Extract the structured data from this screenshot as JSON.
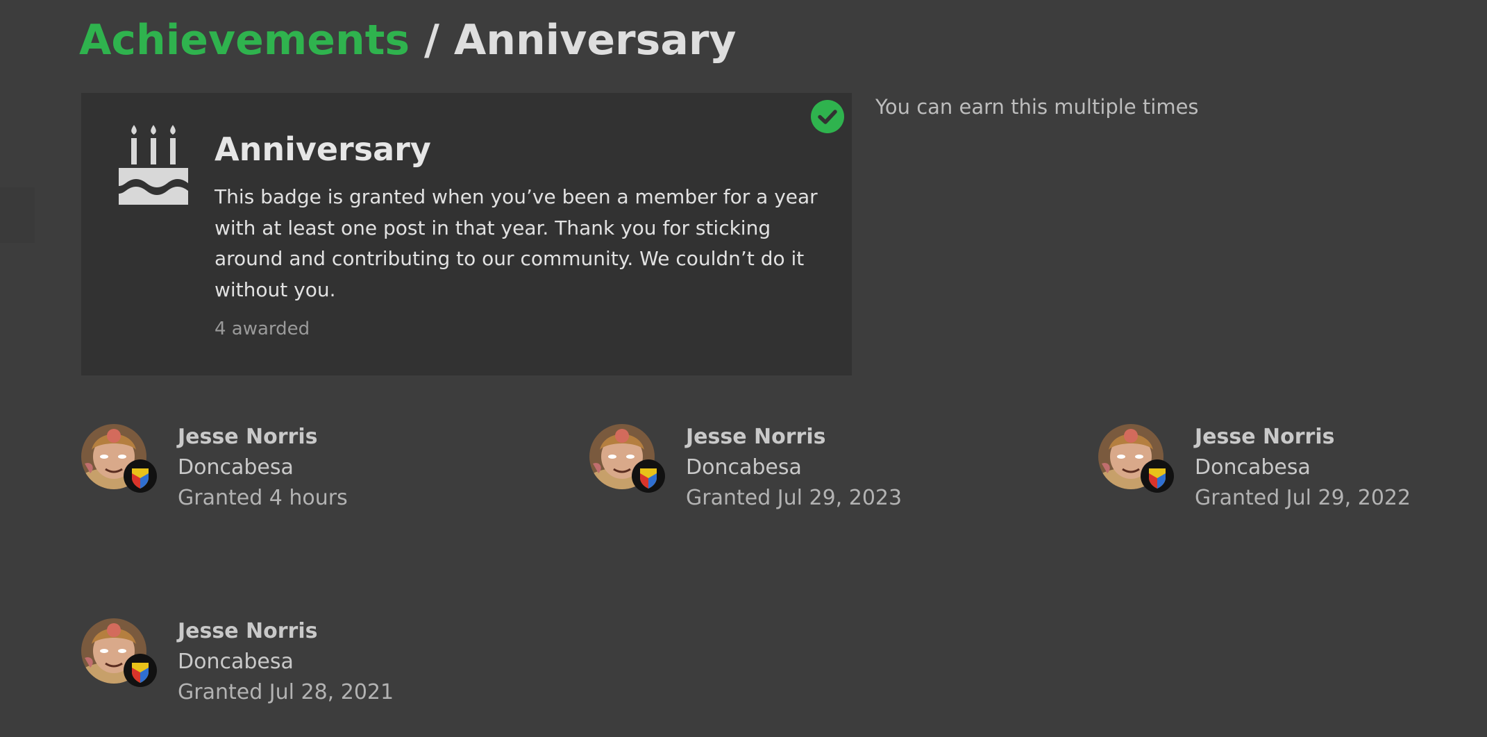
{
  "breadcrumb": {
    "parent": "Achievements",
    "separator": "/",
    "current": "Anniversary"
  },
  "badge": {
    "name": "Anniversary",
    "description": "This badge is granted when you’ve been a member for a year with at least one post in that year. Thank you for sticking around and contributing to our community. We couldn’t do it without you.",
    "awarded_count": "4 awarded",
    "icon": "birthday-cake-icon",
    "earned_icon": "check-circle-icon",
    "earned_color": "#2fb34e"
  },
  "note": "You can earn this multiple times",
  "grants": [
    {
      "username": "Jesse Norris",
      "title": "Doncabesa",
      "granted": "Granted 4 hours"
    },
    {
      "username": "Jesse Norris",
      "title": "Doncabesa",
      "granted": "Granted Jul 29, 2023"
    },
    {
      "username": "Jesse Norris",
      "title": "Doncabesa",
      "granted": "Granted Jul 29, 2022"
    },
    {
      "username": "Jesse Norris",
      "title": "Doncabesa",
      "granted": "Granted Jul 28, 2021"
    }
  ],
  "colors": {
    "accent": "#2fb34e",
    "background": "#3d3d3d",
    "card": "#323232"
  }
}
